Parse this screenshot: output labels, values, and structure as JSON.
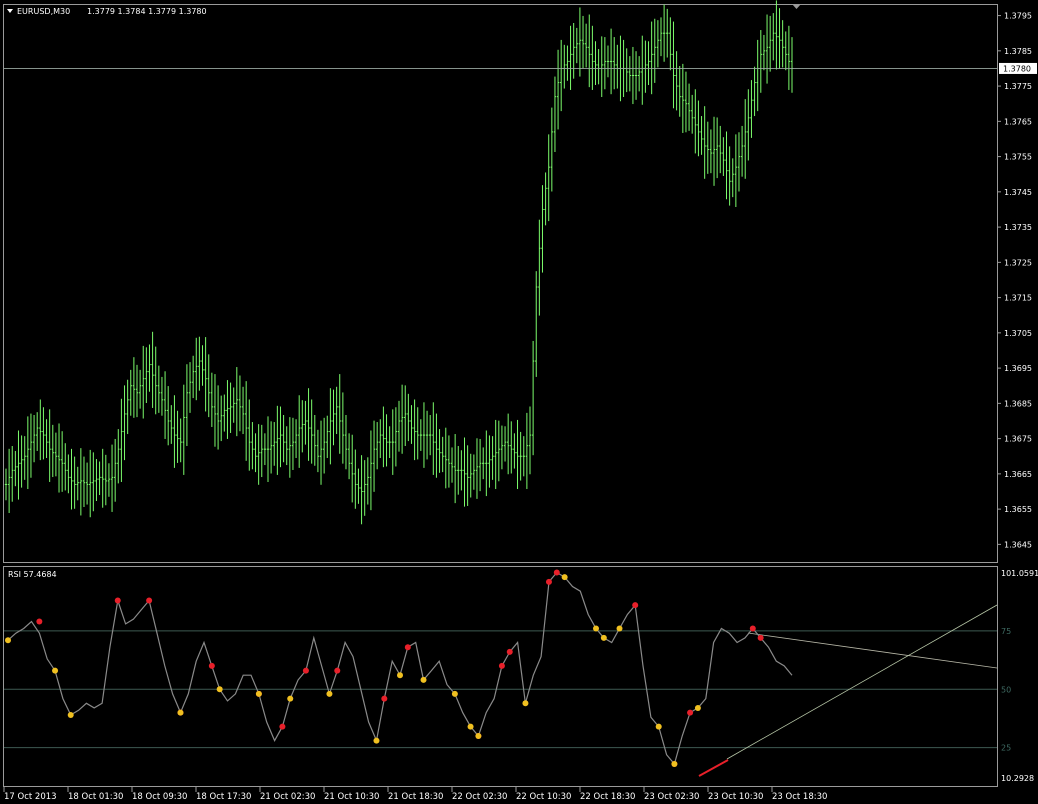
{
  "main_chart": {
    "symbol_label": "EURUSD,M30",
    "ohlc_label": "1.3779 1.3784 1.3779 1.3780",
    "current_price": "1.3780",
    "price_ticks": [
      "1.3795",
      "1.3785",
      "1.3775",
      "1.3765",
      "1.3755",
      "1.3745",
      "1.3735",
      "1.3725",
      "1.3715",
      "1.3705",
      "1.3695",
      "1.3685",
      "1.3675",
      "1.3665",
      "1.3655",
      "1.3645"
    ],
    "y_range": [
      1.364,
      1.3798
    ],
    "price_line": 1.378,
    "bar_color": "#7cfc6c",
    "closes": [
      1.3662,
      1.3666,
      1.3668,
      1.367,
      1.3674,
      1.3678,
      1.3676,
      1.3672,
      1.367,
      1.3668,
      1.3664,
      1.3662,
      1.3663,
      1.3662,
      1.3663,
      1.3664,
      1.3663,
      1.3664,
      1.3672,
      1.3682,
      1.369,
      1.3688,
      1.3692,
      1.3696,
      1.369,
      1.3686,
      1.368,
      1.3676,
      1.3674,
      1.3688,
      1.3694,
      1.3697,
      1.3692,
      1.3684,
      1.368,
      1.3683,
      1.3684,
      1.3686,
      1.3682,
      1.3674,
      1.367,
      1.3672,
      1.3672,
      1.3674,
      1.3676,
      1.3672,
      1.3674,
      1.3678,
      1.368,
      1.3676,
      1.367,
      1.3674,
      1.368,
      1.3684,
      1.3676,
      1.3668,
      1.3662,
      1.366,
      1.3664,
      1.3672,
      1.3676,
      1.3674,
      1.3674,
      1.368,
      1.3682,
      1.3678,
      1.3676,
      1.3676,
      1.3676,
      1.3672,
      1.367,
      1.3668,
      1.3666,
      1.3666,
      1.3664,
      1.3666,
      1.3668,
      1.3668,
      1.367,
      1.3672,
      1.3674,
      1.3672,
      1.367,
      1.367,
      1.3676,
      1.3718,
      1.374,
      1.3752,
      1.3772,
      1.378,
      1.3782,
      1.3786,
      1.3788,
      1.3786,
      1.3782,
      1.378,
      1.3782,
      1.3782,
      1.378,
      1.378,
      1.3778,
      1.3778,
      1.378,
      1.3782,
      1.3786,
      1.379,
      1.379,
      1.3778,
      1.3772,
      1.377,
      1.3766,
      1.3762,
      1.3758,
      1.3756,
      1.3758,
      1.3754,
      1.3748,
      1.3752,
      1.3758,
      1.3766,
      1.3776,
      1.3784,
      1.3786,
      1.379,
      1.3788,
      1.3784,
      1.378
    ]
  },
  "rsi_panel": {
    "label": "RSI 57.4684",
    "y_range": [
      10.2928,
      101.0591
    ],
    "max_label": "101.0591",
    "min_label": "10.2928",
    "levels": [
      {
        "value": 75,
        "label": "75"
      },
      {
        "value": 50,
        "label": "50"
      },
      {
        "value": 25,
        "label": "25"
      }
    ],
    "line_color": "#8a8a8a",
    "high_marker_color": "#e8202a",
    "low_marker_color": "#f0c020",
    "rsi_points": [
      [
        0,
        71
      ],
      [
        5,
        74
      ],
      [
        10,
        76
      ],
      [
        15,
        79
      ],
      [
        20,
        74
      ],
      [
        25,
        63
      ],
      [
        30,
        58
      ],
      [
        35,
        46
      ],
      [
        40,
        39
      ],
      [
        45,
        41
      ],
      [
        50,
        44
      ],
      [
        55,
        42
      ],
      [
        60,
        44
      ],
      [
        65,
        68
      ],
      [
        70,
        88
      ],
      [
        75,
        78
      ],
      [
        80,
        80
      ],
      [
        85,
        84
      ],
      [
        90,
        88
      ],
      [
        95,
        74
      ],
      [
        100,
        60
      ],
      [
        105,
        48
      ],
      [
        110,
        40
      ],
      [
        115,
        48
      ],
      [
        120,
        62
      ],
      [
        125,
        70
      ],
      [
        130,
        60
      ],
      [
        135,
        50
      ],
      [
        140,
        45
      ],
      [
        145,
        48
      ],
      [
        150,
        56
      ],
      [
        155,
        56
      ],
      [
        160,
        48
      ],
      [
        165,
        36
      ],
      [
        170,
        28
      ],
      [
        175,
        34
      ],
      [
        180,
        46
      ],
      [
        185,
        54
      ],
      [
        190,
        58
      ],
      [
        195,
        72
      ],
      [
        200,
        60
      ],
      [
        205,
        48
      ],
      [
        210,
        58
      ],
      [
        215,
        70
      ],
      [
        220,
        64
      ],
      [
        225,
        50
      ],
      [
        230,
        36
      ],
      [
        235,
        28
      ],
      [
        240,
        46
      ],
      [
        245,
        62
      ],
      [
        250,
        56
      ],
      [
        255,
        68
      ],
      [
        260,
        70
      ],
      [
        265,
        54
      ],
      [
        270,
        58
      ],
      [
        275,
        62
      ],
      [
        280,
        52
      ],
      [
        285,
        48
      ],
      [
        290,
        40
      ],
      [
        295,
        34
      ],
      [
        300,
        30
      ],
      [
        305,
        40
      ],
      [
        310,
        46
      ],
      [
        315,
        60
      ],
      [
        320,
        66
      ],
      [
        325,
        70
      ],
      [
        330,
        44
      ],
      [
        335,
        56
      ],
      [
        340,
        64
      ],
      [
        345,
        96
      ],
      [
        350,
        100
      ],
      [
        355,
        98
      ],
      [
        360,
        94
      ],
      [
        365,
        92
      ],
      [
        370,
        82
      ],
      [
        375,
        76
      ],
      [
        380,
        72
      ],
      [
        385,
        70
      ],
      [
        390,
        76
      ],
      [
        395,
        82
      ],
      [
        400,
        86
      ],
      [
        405,
        60
      ],
      [
        410,
        38
      ],
      [
        415,
        34
      ],
      [
        420,
        22
      ],
      [
        425,
        18
      ],
      [
        430,
        30
      ],
      [
        435,
        40
      ],
      [
        440,
        42
      ],
      [
        445,
        46
      ],
      [
        450,
        70
      ],
      [
        455,
        76
      ],
      [
        460,
        74
      ],
      [
        465,
        70
      ],
      [
        470,
        72
      ],
      [
        475,
        76
      ],
      [
        480,
        72
      ],
      [
        485,
        68
      ],
      [
        490,
        62
      ],
      [
        495,
        60
      ],
      [
        500,
        56
      ]
    ],
    "markers_high": [
      [
        20,
        79
      ],
      [
        70,
        88
      ],
      [
        90,
        88
      ],
      [
        110,
        40
      ],
      [
        130,
        60
      ],
      [
        160,
        48
      ],
      [
        175,
        34
      ],
      [
        190,
        58
      ],
      [
        210,
        58
      ],
      [
        240,
        46
      ],
      [
        255,
        68
      ],
      [
        300,
        30
      ],
      [
        315,
        60
      ],
      [
        320,
        66
      ],
      [
        345,
        96
      ],
      [
        350,
        100
      ],
      [
        400,
        86
      ],
      [
        425,
        18
      ],
      [
        435,
        40
      ],
      [
        475,
        76
      ],
      [
        480,
        72
      ]
    ],
    "markers_low": [
      [
        0,
        71
      ],
      [
        30,
        58
      ],
      [
        40,
        39
      ],
      [
        110,
        40
      ],
      [
        135,
        50
      ],
      [
        160,
        48
      ],
      [
        180,
        46
      ],
      [
        205,
        48
      ],
      [
        235,
        28
      ],
      [
        250,
        56
      ],
      [
        265,
        54
      ],
      [
        285,
        48
      ],
      [
        295,
        34
      ],
      [
        300,
        30
      ],
      [
        330,
        44
      ],
      [
        355,
        98
      ],
      [
        375,
        76
      ],
      [
        380,
        72
      ],
      [
        390,
        76
      ],
      [
        415,
        34
      ],
      [
        425,
        18
      ],
      [
        440,
        42
      ]
    ]
  },
  "time_axis": {
    "labels": [
      "17 Oct 2013",
      "18 Oct 01:30",
      "18 Oct 09:30",
      "18 Oct 17:30",
      "21 Oct 02:30",
      "21 Oct 10:30",
      "21 Oct 18:30",
      "22 Oct 02:30",
      "22 Oct 10:30",
      "22 Oct 18:30",
      "23 Oct 02:30",
      "23 Oct 10:30",
      "23 Oct 18:30"
    ]
  }
}
